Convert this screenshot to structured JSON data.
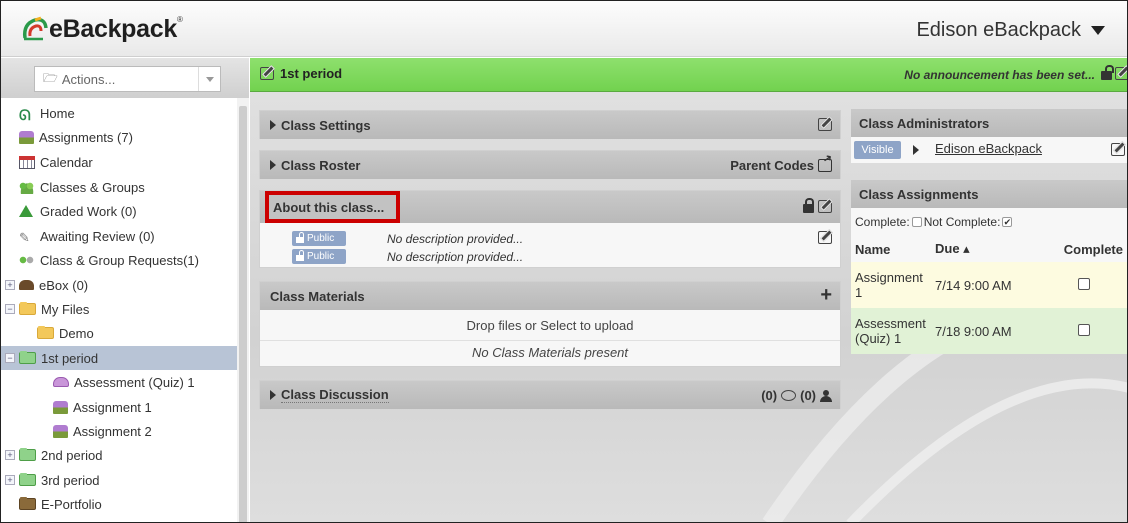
{
  "brand": {
    "name": "eBackpack",
    "reg": "®"
  },
  "user_menu": {
    "label": "Edison eBackpack"
  },
  "actions": {
    "placeholder": "Actions..."
  },
  "sidebar": {
    "items": [
      {
        "label": "Home"
      },
      {
        "label": "Assignments (7)"
      },
      {
        "label": "Calendar"
      },
      {
        "label": "Classes & Groups"
      },
      {
        "label": "Graded Work (0)"
      },
      {
        "label": "Awaiting Review (0)"
      },
      {
        "label": "Class & Group Requests(1)"
      },
      {
        "label": "eBox (0)"
      },
      {
        "label": "My Files"
      },
      {
        "label": "Demo"
      },
      {
        "label": "1st period"
      },
      {
        "label": "Assessment (Quiz) 1"
      },
      {
        "label": "Assignment 1"
      },
      {
        "label": "Assignment 2"
      },
      {
        "label": "2nd period"
      },
      {
        "label": "3rd period"
      },
      {
        "label": "E-Portfolio"
      }
    ]
  },
  "class_bar": {
    "title": "1st period",
    "announcement": "No announcement has been set..."
  },
  "panels": {
    "settings": {
      "title": "Class Settings"
    },
    "roster": {
      "title": "Class Roster",
      "parent_codes": "Parent Codes"
    },
    "about": {
      "title": "About this class...",
      "rows": [
        {
          "badge": "Public",
          "text": "No description provided..."
        },
        {
          "badge": "Public",
          "text": "No description provided..."
        }
      ]
    },
    "materials": {
      "title": "Class Materials",
      "drop": "Drop files or Select to upload",
      "empty": "No Class Materials present"
    },
    "discussion": {
      "title": "Class Discussion",
      "count1": "(0)",
      "count2": "(0)"
    }
  },
  "administrators": {
    "title": "Class Administrators",
    "badge": "Visible",
    "name": "Edison eBackpack"
  },
  "assignments_panel": {
    "title": "Class Assignments",
    "complete_label": "Complete:",
    "not_complete_label": "Not Complete:",
    "columns": [
      "Name",
      "Due ▴",
      "Complete"
    ],
    "rows": [
      {
        "name_line1": "Assignment",
        "name_line2": "1",
        "due": "7/14 9:00 AM"
      },
      {
        "name_line1": "Assessment",
        "name_line2": "(Quiz) 1",
        "due": "7/18 9:00 AM"
      }
    ]
  }
}
